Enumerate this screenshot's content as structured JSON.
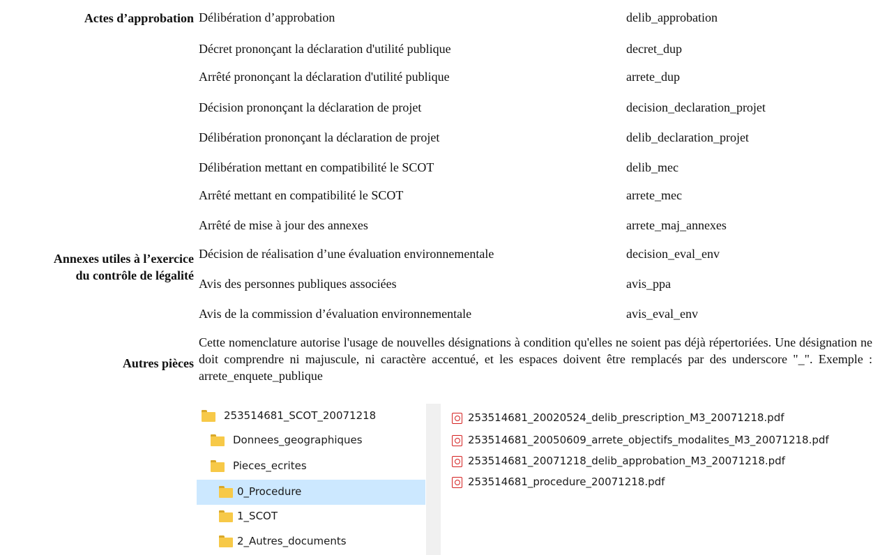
{
  "categories": {
    "approbation": "Actes d’approbation",
    "annexes_line1": "Annexes utiles à l’exercice",
    "annexes_line2": "du contrôle de légalité",
    "autres": "Autres pièces"
  },
  "rows": [
    {
      "desc": "Délibération d’approbation",
      "code": "delib_approbation"
    },
    {
      "desc": "Décret prononçant la déclaration d'utilité publique",
      "code": "decret_dup"
    },
    {
      "desc": "Arrêté prononçant la déclaration d'utilité publique",
      "code": "arrete_dup"
    },
    {
      "desc": "Décision prononçant la déclaration de projet",
      "code": "decision_declaration_projet"
    },
    {
      "desc": "Délibération prononçant la déclaration de projet",
      "code": "delib_declaration_projet"
    },
    {
      "desc": "Délibération mettant en compatibilité le SCOT",
      "code": "delib_mec"
    },
    {
      "desc": "Arrêté mettant en compatibilité le SCOT",
      "code": "arrete_mec"
    },
    {
      "desc": "Arrêté de mise à jour des annexes",
      "code": "arrete_maj_annexes"
    },
    {
      "desc": "Décision de réalisation d’une évaluation environnementale",
      "code": "decision_eval_env"
    },
    {
      "desc": "Avis des personnes publiques associées",
      "code": "avis_ppa"
    },
    {
      "desc": "Avis de la commission d’évaluation environnementale",
      "code": "avis_eval_env"
    }
  ],
  "autres_text": "Cette nomenclature autorise l'usage de nouvelles désignations à condition qu'elles ne soient pas déjà répertoriées. Une désignation ne doit comprendre ni majuscule, ni caractère accentué, et les espaces doivent être remplacés par des underscore \"_\". Exemple : arrete_enquete_publique",
  "tree": [
    {
      "label": "253514681_SCOT_20071218",
      "icon": "folder-icon"
    },
    {
      "label": "Donnees_geographiques",
      "icon": "folder-icon"
    },
    {
      "label": "Pieces_ecrites",
      "icon": "folder-icon"
    },
    {
      "label": "0_Procedure",
      "icon": "folder-icon",
      "selected": true
    },
    {
      "label": "1_SCOT",
      "icon": "folder-icon"
    },
    {
      "label": "2_Autres_documents",
      "icon": "folder-icon"
    }
  ],
  "files": [
    {
      "label": "253514681_20020524_delib_prescription_M3_20071218.pdf",
      "icon": "pdf-icon"
    },
    {
      "label": "253514681_20050609_arrete_objectifs_modalites_M3_20071218.pdf",
      "icon": "pdf-icon"
    },
    {
      "label": "253514681_20071218_delib_approbation_M3_20071218.pdf",
      "icon": "pdf-icon"
    },
    {
      "label": "253514681_procedure_20071218.pdf",
      "icon": "pdf-icon"
    }
  ],
  "colors": {
    "selection": "#cce8ff",
    "folder": "#f7c948",
    "pdf": "#d42020"
  }
}
